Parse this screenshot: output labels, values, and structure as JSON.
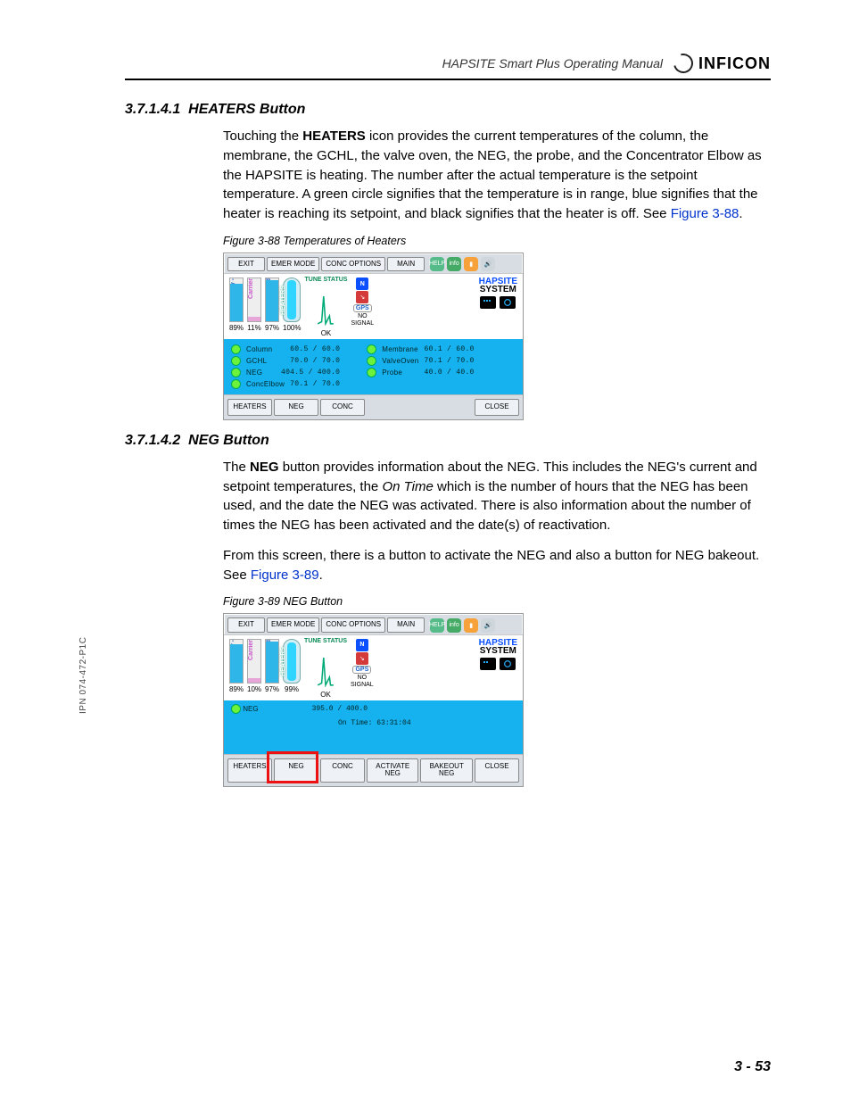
{
  "header": {
    "manual_title": "HAPSITE Smart Plus Operating Manual",
    "brand": "INFICON"
  },
  "side_ipn": "IPN 074-472-P1C",
  "page_number": "3 - 53",
  "sections": {
    "s1": {
      "number": "3.7.1.4.1",
      "title": "HEATERS Button",
      "para1_a": "Touching the ",
      "para1_bold": "HEATERS",
      "para1_b": " icon provides the current temperatures of the column, the membrane, the GCHL, the valve oven, the NEG, the probe, and the Concentrator Elbow as the HAPSITE is heating. The number after the actual temperature is the setpoint temperature. A green circle signifies that the temperature is in range, blue signifies that the heater is reaching its setpoint, and black signifies that the heater is off. See ",
      "para1_link": "Figure 3-88",
      "para1_c": "."
    },
    "s2": {
      "number": "3.7.1.4.2",
      "title": "NEG Button",
      "para1_a": "The ",
      "para1_bold": "NEG",
      "para1_b": " button provides information about the NEG. This includes the NEG's current and setpoint temperatures, the ",
      "para1_ital": "On Time",
      "para1_c": " which is the number of hours that the NEG has been used, and the date the NEG was activated. There is also information about the number of times the NEG has been activated and the date(s) of reactivation.",
      "para2_a": "From this screen, there is a button to activate the NEG and also a button for NEG bakeout. See ",
      "para2_link": "Figure 3-89",
      "para2_b": "."
    }
  },
  "fig88": {
    "caption": "Figure 3-88  Temperatures of Heaters",
    "top": {
      "exit": "EXIT",
      "emer": "EMER MODE",
      "conc": "CONC OPTIONS",
      "main": "MAIN",
      "help": "HELP",
      "info": "info"
    },
    "gauges": {
      "battery_label": "+ Battery -",
      "battery_pct": "89%",
      "carrier_label": "Carrier",
      "carrier_pct": "11%",
      "intstd_label": "Int Std",
      "intstd_pct": "97%",
      "heaters_label": "HEATERS",
      "heaters_pct": "100%",
      "tune": "TUNE STATUS",
      "ok": "OK",
      "sig_n": "N",
      "gps": "GPS",
      "signal_no": "NO",
      "signal_lbl": "SIGNAL",
      "hapsite": "HAPSITE",
      "system": "SYSTEM"
    },
    "heaters_left": [
      {
        "name": "Column",
        "cur": "60.5",
        "sp": "60.0"
      },
      {
        "name": "GCHL",
        "cur": "70.0",
        "sp": "70.0"
      },
      {
        "name": "NEG",
        "cur": "404.5",
        "sp": "400.0"
      },
      {
        "name": "ConcElbow",
        "cur": "70.1",
        "sp": "70.0"
      }
    ],
    "heaters_right": [
      {
        "name": "Membrane",
        "cur": "60.1",
        "sp": "60.0"
      },
      {
        "name": "ValveOven",
        "cur": "70.1",
        "sp": "70.0"
      },
      {
        "name": "Probe",
        "cur": "40.0",
        "sp": "40.0"
      }
    ],
    "bottom": {
      "heaters": "HEATERS",
      "neg": "NEG",
      "conc": "CONC",
      "close": "CLOSE"
    }
  },
  "fig89": {
    "caption": "Figure 3-89  NEG Button",
    "top": {
      "exit": "EXIT",
      "emer": "EMER MODE",
      "conc": "CONC OPTIONS",
      "main": "MAIN",
      "help": "HELP",
      "info": "info"
    },
    "gauges": {
      "battery_label": "+ Battery -",
      "battery_pct": "89%",
      "carrier_label": "Carrier",
      "carrier_pct": "10%",
      "intstd_label": "Int Std",
      "intstd_pct": "97%",
      "heaters_label": "HEATERS",
      "heaters_pct": "99%",
      "tune": "TUNE STATUS",
      "ok": "OK",
      "sig_n": "N",
      "gps": "GPS",
      "signal_no": "NO",
      "signal_lbl": "SIGNAL",
      "hapsite": "HAPSITE",
      "system": "SYSTEM"
    },
    "neg_row": {
      "label": "NEG",
      "cur": "395.0",
      "sp": "400.0"
    },
    "ontime_label": "On Time:",
    "ontime_value": "63:31:04",
    "bottom": {
      "heaters": "HEATERS",
      "neg": "NEG",
      "conc": "CONC",
      "act": "ACTIVATE NEG",
      "bake": "BAKEOUT NEG",
      "close": "CLOSE"
    }
  }
}
